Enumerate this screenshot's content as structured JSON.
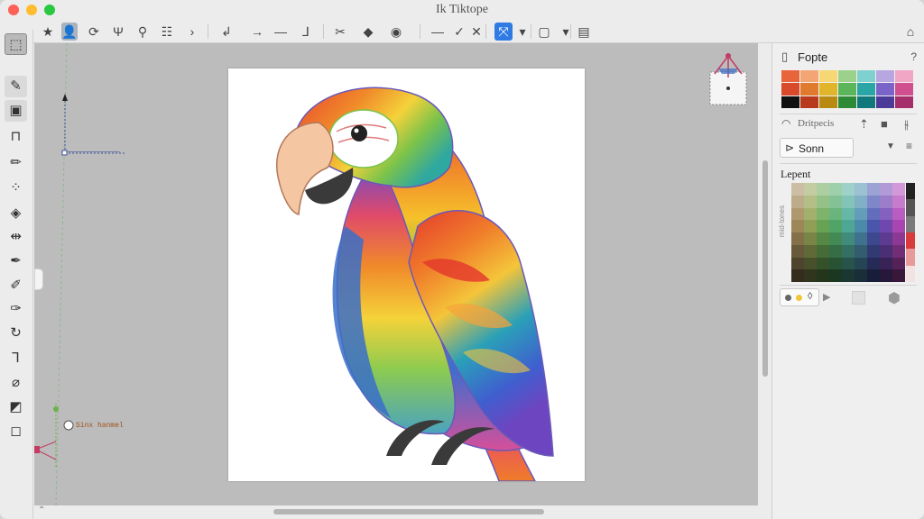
{
  "window": {
    "title": "Ik Tiktope"
  },
  "toolbar": {
    "items": [
      {
        "name": "star-icon",
        "glyph": "★"
      },
      {
        "name": "user-icon",
        "glyph": "👤"
      },
      {
        "name": "clock-icon",
        "glyph": "⟳"
      },
      {
        "name": "fork-icon",
        "glyph": "Ψ"
      },
      {
        "name": "key-icon",
        "glyph": "⚲"
      },
      {
        "name": "layers-icon",
        "glyph": "☷"
      },
      {
        "name": "chevron-right-icon",
        "glyph": "›"
      },
      {
        "name": "pin-icon",
        "glyph": "↲"
      },
      {
        "name": "arrow-right-icon",
        "glyph": "→"
      },
      {
        "name": "line-icon",
        "glyph": "—"
      },
      {
        "name": "corner-icon",
        "glyph": "⅃"
      },
      {
        "name": "scissors-icon",
        "glyph": "✂"
      },
      {
        "name": "tag-icon",
        "glyph": "◆"
      },
      {
        "name": "globe-icon",
        "glyph": "◉"
      },
      {
        "name": "minus-icon",
        "glyph": "—"
      },
      {
        "name": "check-icon",
        "glyph": "✓"
      },
      {
        "name": "cross-tool-icon",
        "glyph": "✕"
      },
      {
        "name": "snap-icon",
        "glyph": "⤧"
      },
      {
        "name": "caret-down-icon",
        "glyph": "▾"
      },
      {
        "name": "frame-icon",
        "glyph": "▢"
      },
      {
        "name": "caret-down-icon-2",
        "glyph": "▾"
      },
      {
        "name": "panel-toggle-icon",
        "glyph": "▤"
      },
      {
        "name": "home-icon",
        "glyph": "⌂"
      }
    ]
  },
  "tools": [
    {
      "name": "selector-tool-icon",
      "glyph": "⬚"
    },
    {
      "name": "node-tool-icon",
      "glyph": "✎"
    },
    {
      "name": "rect-tool-icon",
      "glyph": "▣"
    },
    {
      "name": "bevel-tool-icon",
      "glyph": "⊓"
    },
    {
      "name": "pencil-tool-icon",
      "glyph": "✏"
    },
    {
      "name": "spray-tool-icon",
      "glyph": "⁘"
    },
    {
      "name": "cube-tool-icon",
      "glyph": "◈"
    },
    {
      "name": "connector-tool-icon",
      "glyph": "⇹"
    },
    {
      "name": "pen-tool-icon",
      "glyph": "✒"
    },
    {
      "name": "red-pen-tool-icon",
      "glyph": "✐"
    },
    {
      "name": "calligraphy-tool-icon",
      "glyph": "✑"
    },
    {
      "name": "spiral-tool-icon",
      "glyph": "↻"
    },
    {
      "name": "text-tool-icon",
      "glyph": "Ꞁ"
    },
    {
      "name": "dropper-tool-icon",
      "glyph": "⌀"
    },
    {
      "name": "gradient-tool-icon",
      "glyph": "◩"
    },
    {
      "name": "zoom-tool-icon",
      "glyph": "◻"
    }
  ],
  "panel": {
    "title": "Fopte",
    "help": "?",
    "swatches": [
      "#e8643a",
      "#f4a574",
      "#f7d774",
      "#9bd18b",
      "#7fd1cf",
      "#b8a6e0",
      "#f2a6c6",
      "#d94a2b",
      "#e07a2e",
      "#e0b52a",
      "#5bb55a",
      "#2aa6a6",
      "#7a63c9",
      "#d14f8f",
      "#111111",
      "#b83a1c",
      "#b88a12",
      "#2f8a38",
      "#11797c",
      "#4c3b99",
      "#a52f6a"
    ],
    "dropdown_label": "Dritpecis",
    "select_value": "Sonn",
    "gradient_title": "Lepent",
    "palette_side_label": "mid-tones",
    "palette_side_colors": [
      "#222222",
      "#555555",
      "#7a7a7a",
      "#d93b3b",
      "#e89a9a",
      "#f3e2e2"
    ]
  },
  "canvas": {
    "guide_label_top": "────────────",
    "guide_label_bottom": "Sinx hanmel"
  }
}
